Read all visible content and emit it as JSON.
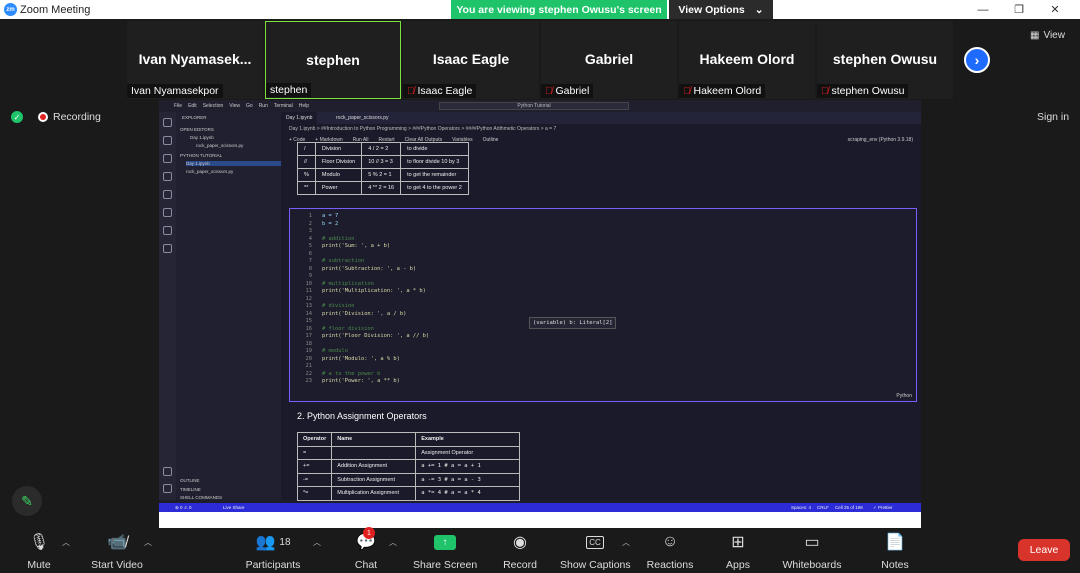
{
  "window": {
    "title": "Zoom Meeting",
    "logo_text": "zm"
  },
  "banner": {
    "text": "You are viewing stephen Owusu's screen",
    "view_options": "View Options"
  },
  "participants_strip": [
    {
      "big": "Ivan  Nyamasek...",
      "small": "Ivan Nyamasekpor",
      "muted": false
    },
    {
      "big": "stephen",
      "small": "stephen",
      "muted": false,
      "active": true
    },
    {
      "big": "Isaac Eagle",
      "small": "Isaac Eagle",
      "muted": true
    },
    {
      "big": "Gabriel",
      "small": "Gabriel",
      "muted": true
    },
    {
      "big": "Hakeem Olord",
      "small": "Hakeem Olord",
      "muted": true
    },
    {
      "big": "stephen Owusu",
      "small": "stephen Owusu",
      "muted": true
    }
  ],
  "view_button": "View",
  "recording_label": "Recording",
  "sign_in": "Sign in",
  "vscode": {
    "menu": [
      "File",
      "Edit",
      "Selection",
      "View",
      "Go",
      "Run",
      "Terminal",
      "Help"
    ],
    "search": "Python Tutorial",
    "explorer": {
      "title": "EXPLORER",
      "open_editors": "OPEN EDITORS",
      "open_files": [
        "Day 1.ipynb",
        "rock_paper_scissors.py"
      ],
      "folder": "PYTHON TUTORIAL",
      "folder_files": [
        "Day 1.ipynb",
        "rock_paper_scissors.py"
      ],
      "outline": "OUTLINE",
      "timeline": "TIMELINE",
      "shell": "SHELL COMMANDS"
    },
    "tabs": [
      "Day 1.ipynb",
      "rock_paper_scissors.py"
    ],
    "breadcrumb": "Day 1.ipynb > ##Introduction to Python Programming > ###Python Operators > ####Python Arithmetic Operators > a = 7",
    "toolbar": [
      "+ Code",
      "+ Markdown",
      "Run All",
      "Restart",
      "Clear All Outputs",
      "Variables",
      "Outline"
    ],
    "kernel": "scraping_env (Python 3.9.18)",
    "op_table": [
      [
        "/",
        "Division",
        "4 / 2 = 2",
        "to divide"
      ],
      [
        "//",
        "Floor Division",
        "10 // 3 = 3",
        "to floor divide 10 by 3"
      ],
      [
        "%",
        "Modulo",
        "5 % 2 = 1",
        "to get the remainder"
      ],
      [
        "**",
        "Power",
        "4 ** 2 = 16",
        "to get 4 to the power 2"
      ]
    ],
    "code_lines": [
      "a = 7",
      "b = 2",
      "",
      "# addition",
      "print('Sum: ', a + b)",
      "",
      "# subtraction",
      "print('Subtraction: ', a - b)",
      "",
      "# multiplication",
      "print('Multiplication: ', a * b)",
      "",
      "# division",
      "print('Division: ', a / b)",
      "",
      "# floor division",
      "print('Floor Division: ', a // b)",
      "",
      "# modulo",
      "print('Modulo: ', a % b)",
      "",
      "# a to the power b",
      "print('Power: ', a ** b)"
    ],
    "tooltip": "(variable) b: Literal[2]",
    "cell_language": "Python",
    "section_heading": "2. Python Assignment Operators",
    "asn_table": {
      "headers": [
        "Operator",
        "Name",
        "Example"
      ],
      "rows": [
        [
          "=",
          "",
          "Assignment Operator"
        ],
        [
          "+=",
          "Addition Assignment",
          "a += 1 # a = a + 1"
        ],
        [
          "-=",
          "Subtraction Assignment",
          "a -= 3 # a = a - 3"
        ],
        [
          "*=",
          "Multiplication Assignment",
          "a *= 4 # a = a * 4"
        ]
      ]
    },
    "status": {
      "left": "⊗ 0 ⚠ 0",
      "live_share": "Live Share",
      "spaces": "Spaces: 4",
      "eol": "CRLF",
      "cell": "Cell 25 of 198",
      "prettier": "✓ Prettier"
    }
  },
  "toolbar": {
    "mute": "Mute",
    "start_video": "Start Video",
    "participants": "Participants",
    "participants_count": "18",
    "chat": "Chat",
    "chat_badge": "1",
    "share_screen": "Share Screen",
    "record": "Record",
    "captions": "Show Captions",
    "captions_icon": "CC",
    "reactions": "Reactions",
    "apps": "Apps",
    "whiteboards": "Whiteboards",
    "notes": "Notes",
    "leave": "Leave"
  },
  "colors": {
    "banner_green": "#1ec36a",
    "leave_red": "#d9342b",
    "accent_blue": "#1f6bff"
  }
}
